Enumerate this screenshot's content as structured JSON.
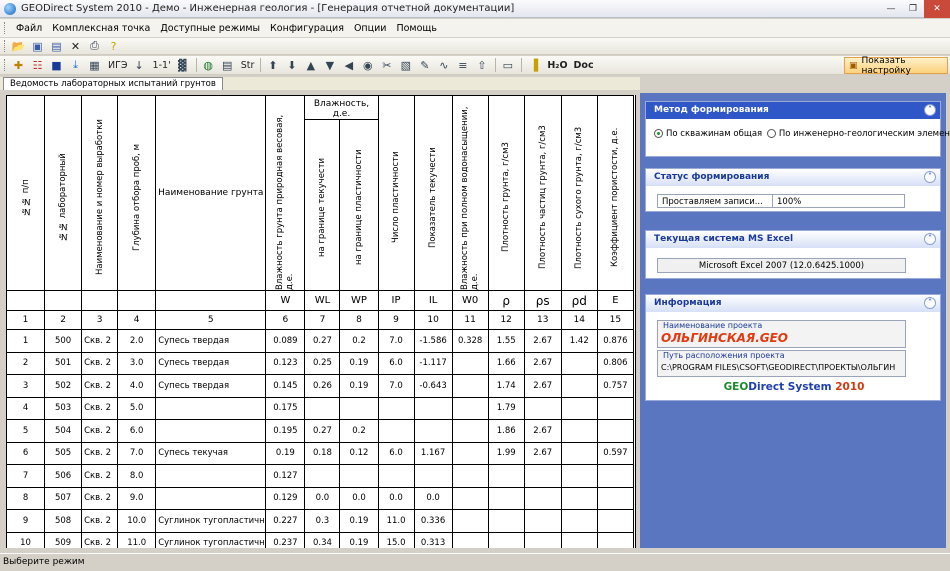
{
  "window": {
    "title": "GEODirect System 2010 - Демо - Инженерная геология - [Генерация отчетной документации]"
  },
  "menu": [
    "Файл",
    "Комплексная точка",
    "Доступные режимы",
    "Конфигурация",
    "Опции",
    "Помощь"
  ],
  "toolbar": {
    "ige_label": "ИГЭ",
    "one_one_label": "1-1'",
    "str_label": "Str",
    "h2o_label": "H₂O",
    "doc_label": "Doc",
    "show_settings_label": "Показать настройку"
  },
  "tab": {
    "label": "Ведомость лабораторных испытаний грунтов"
  },
  "table": {
    "h": {
      "c1": "№№ п/п",
      "c2": "№№ лабораторный",
      "c3": "Наименование и номер выработки",
      "c4": "Глубина отбора проб, м",
      "c5": "Наименование грунта",
      "c6": "Влажность грунта природная весовая, д.е.",
      "c7_8": "Влажность, д.е.",
      "c7": "на границе текучести",
      "c8": "на границе пластичности",
      "c9": "Число пластичности",
      "c10": "Показатель текучести",
      "c11": "Влажность при полном водонасыщении, д.е.",
      "c12": "Плотность грунта, г/см3",
      "c13": "Плотность частиц грунта, г/см3",
      "c14": "Плотность сухого грунта, г/см3",
      "c15": "Коэффициент пористости, д.е."
    },
    "symbols": [
      "W",
      "WL",
      "WP",
      "IP",
      "IL",
      "W0",
      "ρ",
      "ρs",
      "ρd",
      "E"
    ],
    "numbers": [
      "1",
      "2",
      "3",
      "4",
      "5",
      "6",
      "7",
      "8",
      "9",
      "10",
      "11",
      "12",
      "13",
      "14",
      "15"
    ],
    "rows": [
      [
        "1",
        "500",
        "Скв. 2",
        "2.0",
        "Супесь твердая",
        "0.089",
        "0.27",
        "0.2",
        "7.0",
        "-1.586",
        "0.328",
        "1.55",
        "2.67",
        "1.42",
        "0.876"
      ],
      [
        "2",
        "501",
        "Скв. 2",
        "3.0",
        "Супесь твердая",
        "0.123",
        "0.25",
        "0.19",
        "6.0",
        "-1.117",
        "",
        "1.66",
        "2.67",
        "",
        "0.806"
      ],
      [
        "3",
        "502",
        "Скв. 2",
        "4.0",
        "Супесь твердая",
        "0.145",
        "0.26",
        "0.19",
        "7.0",
        "-0.643",
        "",
        "1.74",
        "2.67",
        "",
        "0.757"
      ],
      [
        "4",
        "503",
        "Скв. 2",
        "5.0",
        "",
        "0.175",
        "",
        "",
        "",
        "",
        "",
        "1.79",
        "",
        "",
        ""
      ],
      [
        "5",
        "504",
        "Скв. 2",
        "6.0",
        "",
        "0.195",
        "0.27",
        "0.2",
        "",
        "",
        "",
        "1.86",
        "2.67",
        "",
        ""
      ],
      [
        "6",
        "505",
        "Скв. 2",
        "7.0",
        "Супесь текучая",
        "0.19",
        "0.18",
        "0.12",
        "6.0",
        "1.167",
        "",
        "1.99",
        "2.67",
        "",
        "0.597"
      ],
      [
        "7",
        "506",
        "Скв. 2",
        "8.0",
        "",
        "0.127",
        "",
        "",
        "",
        "",
        "",
        "",
        "",
        "",
        ""
      ],
      [
        "8",
        "507",
        "Скв. 2",
        "9.0",
        "",
        "0.129",
        "0.0",
        "0.0",
        "0.0",
        "0.0",
        "",
        "",
        "",
        "",
        ""
      ],
      [
        "9",
        "508",
        "Скв. 2",
        "10.0",
        "Суглинок тугопластичный",
        "0.227",
        "0.3",
        "0.19",
        "11.0",
        "0.336",
        "",
        "",
        "",
        "",
        ""
      ],
      [
        "10",
        "509",
        "Скв. 2",
        "11.0",
        "Суглинок тугопластичный",
        "0.237",
        "0.34",
        "0.19",
        "15.0",
        "0.313",
        "",
        "",
        "",
        "",
        ""
      ]
    ]
  },
  "panel": {
    "method": {
      "title": "Метод формирования",
      "opt1": "По скважинам общая",
      "opt2": "По инженерно-геологическим элементам"
    },
    "status": {
      "title": "Статус формирования",
      "text": "Проставляем записи...",
      "percent": "100%"
    },
    "excel": {
      "title": "Текущая система MS Excel",
      "value": "Microsoft Excel 2007 (12.0.6425.1000)"
    },
    "info": {
      "title": "Информация",
      "proj_label": "Наименование проекта",
      "proj_name": "ОЛЬГИНСКАЯ.GEO",
      "path_label": "Путь расположения проекта",
      "path": "C:\\PROGRAM FILES\\CSOFT\\GEODIRECT\\ПРОЕКТЫ\\ОЛЬГИН",
      "logo_geo": "GEO",
      "logo_rest": "Direct System",
      "logo_year": "2010"
    }
  },
  "status": {
    "text": "Выберите режим"
  },
  "colors": {
    "panel_bg": "#5b76c0",
    "header_blue": "#2f57c8",
    "project_red": "#e23a10",
    "logo_blue": "#1e3fae"
  }
}
